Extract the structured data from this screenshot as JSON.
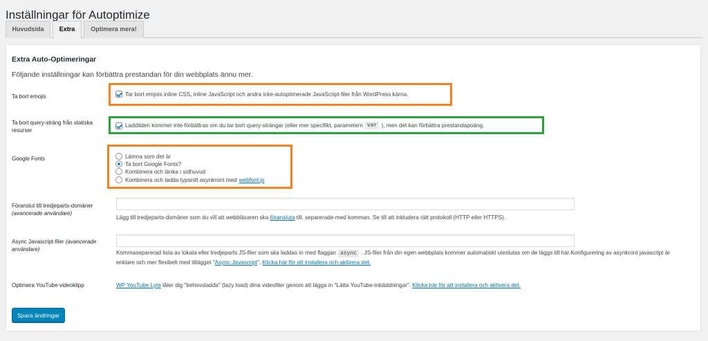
{
  "page": {
    "title": "Inställningar för Autoptimize"
  },
  "tabs": [
    {
      "label": "Huvudsida"
    },
    {
      "label": "Extra"
    },
    {
      "label": "Optimera mera!"
    }
  ],
  "section": {
    "title": "Extra Auto-Optimeringar",
    "description": "Följande inställningar kan förbättra prestandan för din webbplats ännu mer."
  },
  "emojis": {
    "label": "Ta bort emojis",
    "checkbox_text": "Tar bort emjois inline CSS, inline JavaScript och andra icke-autoptimerade JavaScript-filer från WordPress kärna."
  },
  "querystring": {
    "label": "Ta bort query-sträng från statiska resurser",
    "text_before": "Laddtiden kommer inte förbättras om du tar bort query-strängar (eller mer specifikt, parametern",
    "code": "ver",
    "text_after": "), men det kan förbättra prestandapoäng."
  },
  "google_fonts": {
    "label": "Google Fonts",
    "options": [
      {
        "label": "Lämna som det är"
      },
      {
        "label": "Ta bort Google Fonts?"
      },
      {
        "label": "Kombinera och länka i sidhuvud"
      },
      {
        "label": "Kombinera och ladda typsnitt asynkront med",
        "link": "webfont.js"
      }
    ],
    "selected_index": 1
  },
  "preconnect": {
    "label": "Föranslut till tredjeparts-domäner",
    "label_hint": "(avancerade användare)",
    "value": "",
    "help_before": "Lägg till tredjeparts-domäner som du vill att webbläsaren ska",
    "help_link": "föransluta",
    "help_after": "till, separerade med komman. Se till att inkludera rätt protokoll (HTTP eller HTTPS)."
  },
  "async_js": {
    "label": "Async Javascript-filer",
    "label_hint": "(avancerade användare)",
    "value": "",
    "help_before": "Kommaseparerad lista av lokala eller tredjeparts JS-filer som ska laddas in med flaggan",
    "help_code": "async",
    "help_mid": ". JS-filer från din egen webbplats kommer automatiskt uteslutas om de läggs till här.Konfigurering av asynkront javascript är enklare och mer flexibelt med tillägget \"",
    "help_link1": "Async Javascript",
    "help_mid2": "\".",
    "help_link2": "Klicka här för att installera och aktivera det."
  },
  "youtube": {
    "label": "Optimera YouTube-videoklipp",
    "link1": "WP YouTube Lyte",
    "text": "låter dig \"behovsladda\" (lazy load) dina videofiler genom att lägga in \"Lätta YouTube-inbäddningar\".",
    "link2": "Klicka här för att installera och aktivera det."
  },
  "actions": {
    "save_label": "Spara ändringar"
  },
  "colors": {
    "highlight_orange": "#f58220",
    "highlight_green": "#2aa33b",
    "primary_button": "#0085ba",
    "link": "#0073aa"
  }
}
